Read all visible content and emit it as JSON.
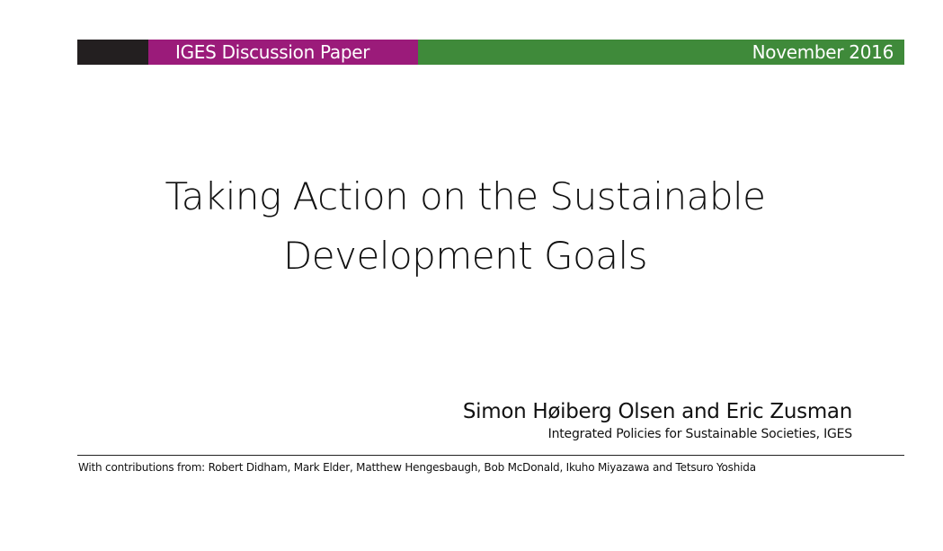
{
  "header": {
    "series_label": "IGES Discussion Paper",
    "date": "November 2016",
    "colors": {
      "dark": "#231f20",
      "purple": "#9b1b7a",
      "green": "#3f8a3a"
    }
  },
  "title": {
    "line1": "Taking Action on the Sustainable",
    "line2": "Development Goals"
  },
  "authors": {
    "names": "Simon Høiberg Olsen and Eric Zusman",
    "affiliation": "Integrated Policies for Sustainable Societies, IGES"
  },
  "contributions": {
    "text": "With contributions from: Robert Didham, Mark Elder, Matthew Hengesbaugh, Bob McDonald, Ikuho Miyazawa and Tetsuro Yoshida"
  }
}
